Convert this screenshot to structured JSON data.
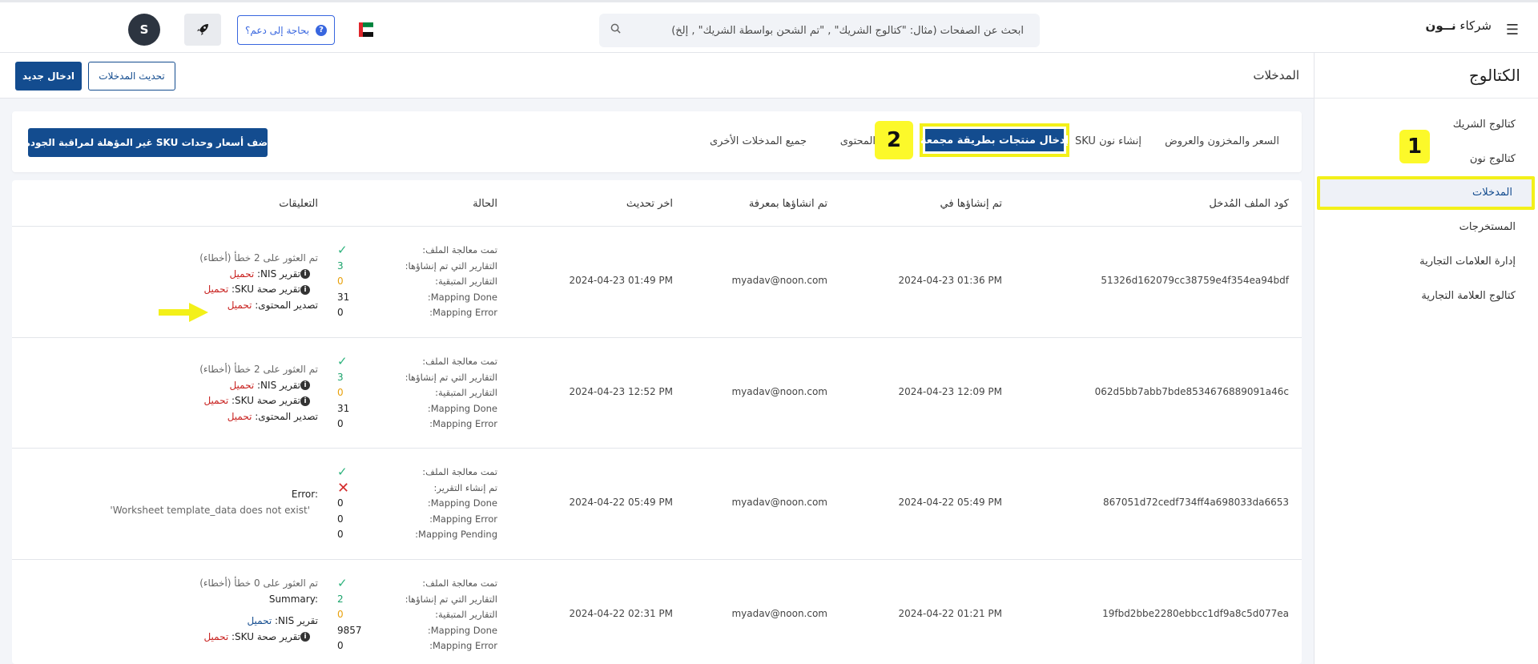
{
  "topbar": {
    "brand_prefix": "شركاء",
    "brand_name": "نــون",
    "search_placeholder": "ابحث عن الصفحات (مثال: \"كتالوج الشريك\" , \"تم الشحن بواسطة الشريك\" , إلخ)",
    "help_label": "بحاجة إلى دعم؟",
    "avatar_initial": "S"
  },
  "sidebar": {
    "title": "الكتالوج",
    "items": [
      {
        "label": "كتالوج الشريك"
      },
      {
        "label": "كتالوج نون"
      },
      {
        "label": "المدخلات"
      },
      {
        "label": "المستخرجات"
      },
      {
        "label": "إدارة العلامات التجارية"
      },
      {
        "label": "كتالوج العلامة التجارية"
      }
    ]
  },
  "callouts": {
    "one": "1",
    "two": "2"
  },
  "subheader": {
    "title": "المدخلات",
    "new_entry": "ادخال جديد",
    "refresh": "تحديث المدخلات"
  },
  "tabs": {
    "price_stock": "السعر والمخزون والعروض",
    "create_sku": "إنشاء نون SKU",
    "bulk_upload": "إدخال منتجات بطريقة مجمعة",
    "content": "المحتوى",
    "all_entries": "جميع المدخلات الأخرى",
    "qc_button": "أضف أسعار وحدات SKU غير المؤهلة لمراقبة الجودة"
  },
  "table": {
    "headers": {
      "file_code": "كود الملف المُدخل",
      "created_at": "تم إنشاؤها في",
      "created_by": "تم انشاؤها بمعرفة",
      "last_update": "اخر تحديث",
      "status": "الحالة",
      "comments": "التعليقات"
    },
    "rows": [
      {
        "file_code": "51326d162079cc38759e4f354ea94bdf",
        "created_at": "2024-04-23 01:36 PM",
        "created_by": "myadav@noon.com",
        "last_update": "2024-04-23 01:49 PM",
        "status_labels": [
          "تمت معالجة الملف:",
          "التقارير التي تم إنشاؤها:",
          "التقارير المتبقية:",
          "Mapping Done:",
          "Mapping Error:"
        ],
        "status_values": [
          "3",
          "0",
          "31",
          "0"
        ],
        "comment_summary": "تم العثور على 2 خطأ (أخطاء)",
        "nis_label": "تقرير NIS:",
        "nis_link": "تحميل",
        "sku_label": "تقرير صحة SKU:",
        "sku_link": "تحميل",
        "export_label": "تصدير المحتوى:",
        "export_link": "تحميل"
      },
      {
        "file_code": "062d5bb7abb7bde8534676889091a46c",
        "created_at": "2024-04-23 12:09 PM",
        "created_by": "myadav@noon.com",
        "last_update": "2024-04-23 12:52 PM",
        "status_labels": [
          "تمت معالجة الملف:",
          "التقارير التي تم إنشاؤها:",
          "التقارير المتبقية:",
          "Mapping Done:",
          "Mapping Error:"
        ],
        "status_values": [
          "3",
          "0",
          "31",
          "0"
        ],
        "comment_summary": "تم العثور على 2 خطأ (أخطاء)",
        "nis_label": "تقرير NIS:",
        "nis_link": "تحميل",
        "sku_label": "تقرير صحة SKU:",
        "sku_link": "تحميل",
        "export_label": "تصدير المحتوى:",
        "export_link": "تحميل"
      },
      {
        "file_code": "867051d72cedf734ff4a698033da6653",
        "created_at": "2024-04-22 05:49 PM",
        "created_by": "myadav@noon.com",
        "last_update": "2024-04-22 05:49 PM",
        "status_labels": [
          "تمت معالجة الملف:",
          "تم إنشاء التقرير:",
          "Mapping Done:",
          "Mapping Error:",
          "Mapping Pending:"
        ],
        "status_values": [
          "0",
          "0",
          "0"
        ],
        "error_label": "Error:",
        "error_text": "'Worksheet template_data does not exist'"
      },
      {
        "file_code": "19fbd2bbe2280ebbcc1df9a8c5d077ea",
        "created_at": "2024-04-22 01:21 PM",
        "created_by": "myadav@noon.com",
        "last_update": "2024-04-22 02:31 PM",
        "status_labels": [
          "تمت معالجة الملف:",
          "التقارير التي تم إنشاؤها:",
          "التقارير المتبقية:",
          "Mapping Done:",
          "Mapping Error:"
        ],
        "status_values": [
          "2",
          "0",
          "9857",
          "0"
        ],
        "comment_summary": "تم العثور على 0 خطأ (أخطاء)",
        "summary_label": "Summary:",
        "nis_label": "تقرير NIS:",
        "nis_link": "تحميل",
        "sku_label": "تقرير صحة SKU:",
        "sku_link": "تحميل"
      }
    ]
  },
  "colors": {
    "primary": "#134c8f",
    "highlight": "#fcf92a",
    "download_red": "#c8201e",
    "success": "#2eb37d",
    "error": "#d42c2c",
    "warning": "#e8a10c"
  }
}
